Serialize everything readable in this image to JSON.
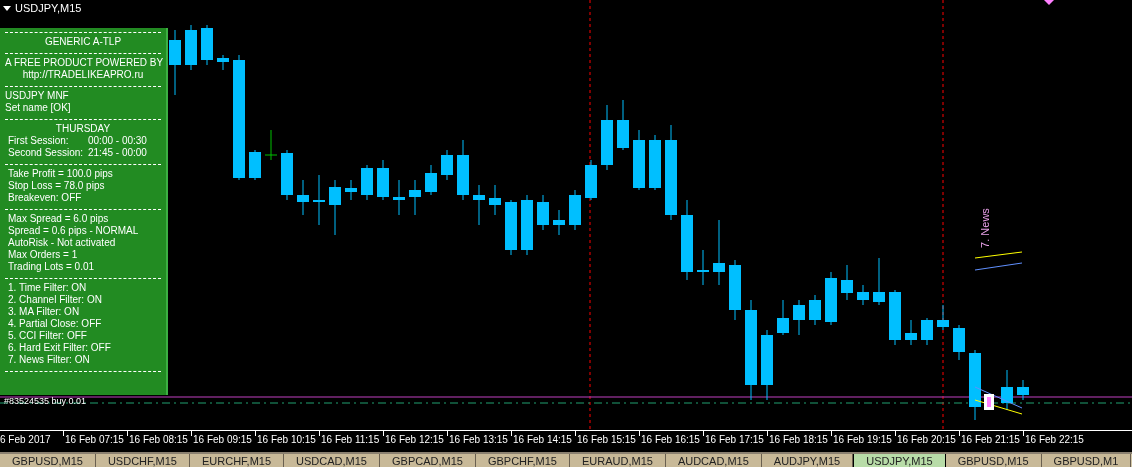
{
  "chart_title": "USDJPY,M15",
  "panel": {
    "sections": [
      {
        "kind": "center",
        "lines": [
          "GENERIC A-TLP"
        ]
      },
      {
        "kind": "center",
        "lines": [
          "A FREE PRODUCT POWERED BY",
          "http://TRADELIKEAPRO.ru"
        ]
      },
      {
        "kind": "left",
        "lines": [
          "USDJPY MNF",
          "Set name [OK]"
        ]
      },
      {
        "kind": "sessions",
        "heading": "THURSDAY",
        "rows": [
          {
            "label": "First Session:",
            "value": "00:00 - 00:30"
          },
          {
            "label": "Second Session:",
            "value": "21:45 - 00:00"
          }
        ]
      },
      {
        "kind": "indent",
        "lines": [
          "Take Profit = 100.0 pips",
          "Stop Loss = 78.0 pips",
          "Breakeven: OFF"
        ]
      },
      {
        "kind": "indent",
        "lines": [
          "Max Spread = 6.0 pips",
          "Spread = 0.6 pips - NORMAL",
          "AutoRisk - Not activated",
          "Max Orders = 1",
          "Trading Lots = 0.01"
        ]
      },
      {
        "kind": "indent",
        "lines": [
          "1. Time Filter: ON",
          "2. Channel Filter: ON",
          "3. MA Filter: ON",
          "4. Partial Close: OFF",
          "5. CCI Filter: OFF",
          "6. Hard Exit Filter: OFF",
          "7. News Filter: ON"
        ]
      }
    ]
  },
  "order_label": "#83524535 buy 0.01",
  "news_label": "7. News",
  "time_axis": [
    "6 Feb 2017",
    "16 Feb 07:15",
    "16 Feb 08:15",
    "16 Feb 09:15",
    "16 Feb 10:15",
    "16 Feb 11:15",
    "16 Feb 12:15",
    "16 Feb 13:15",
    "16 Feb 14:15",
    "16 Feb 15:15",
    "16 Feb 16:15",
    "16 Feb 17:15",
    "16 Feb 18:15",
    "16 Feb 19:15",
    "16 Feb 20:15",
    "16 Feb 21:15",
    "16 Feb 22:15"
  ],
  "tabs": [
    {
      "label": "GBPUSD,M15",
      "selected": false
    },
    {
      "label": "USDCHF,M15",
      "selected": false
    },
    {
      "label": "EURCHF,M15",
      "selected": false
    },
    {
      "label": "USDCAD,M15",
      "selected": false
    },
    {
      "label": "GBPCAD,M15",
      "selected": false
    },
    {
      "label": "GBPCHF,M15",
      "selected": false
    },
    {
      "label": "EURAUD,M15",
      "selected": false
    },
    {
      "label": "AUDCAD,M15",
      "selected": false
    },
    {
      "label": "AUDJPY,M15",
      "selected": false
    },
    {
      "label": "USDJPY,M15",
      "selected": true
    },
    {
      "label": "GBPUSD,M15",
      "selected": false
    },
    {
      "label": "GBPUSD,M1",
      "selected": false
    }
  ]
}
